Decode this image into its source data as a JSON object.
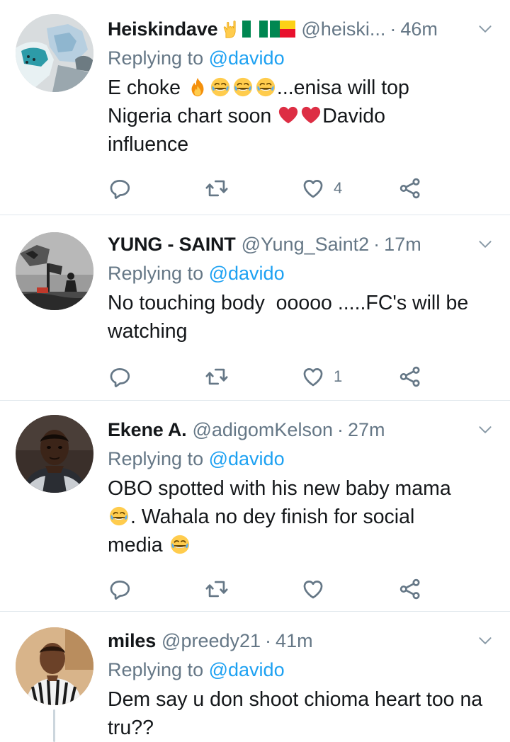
{
  "tweets": [
    {
      "name": "Heiskindave",
      "handle": "@heiski...",
      "sep": "·",
      "time": "46m",
      "reply_prefix": "Replying to",
      "reply_to": "@davido",
      "text_parts": [
        "E choke",
        "...enisa will top",
        "Nigeria chart soon",
        "Davido",
        "influence"
      ],
      "likes": "4",
      "badge_icons": [
        "rock-hand-icon",
        "nigeria-flag-icon",
        "benin-flag-icon"
      ]
    },
    {
      "name": "YUNG - SAINT",
      "handle": "@Yung_Saint2",
      "sep": "·",
      "time": "17m",
      "reply_prefix": "Replying to",
      "reply_to": "@davido",
      "text": "No touching body  ooooo .....FC's will be watching",
      "likes": "1"
    },
    {
      "name": "Ekene A.",
      "handle": "@adigomKelson",
      "sep": "·",
      "time": "27m",
      "reply_prefix": "Replying to",
      "reply_to": "@davido",
      "text_parts": [
        "OBO spotted with his new baby mama",
        ". Wahala no dey finish for social",
        "media"
      ],
      "likes": ""
    },
    {
      "name": "miles",
      "handle": "@preedy21",
      "sep": "·",
      "time": "41m",
      "reply_prefix": "Replying to",
      "reply_to": "@davido",
      "text": "Dem say u don shoot chioma heart too na tru??"
    }
  ],
  "colors": {
    "text": "#14171a",
    "secondary": "#657786",
    "link": "#1da1f2",
    "divider": "#e1e8ed",
    "heart_emoji": "#dd2e44"
  },
  "icons": [
    "reply-icon",
    "retweet-icon",
    "like-icon",
    "share-icon",
    "chevron-down-icon",
    "fire-emoji-icon",
    "joy-emoji-icon",
    "red-heart-emoji-icon"
  ]
}
